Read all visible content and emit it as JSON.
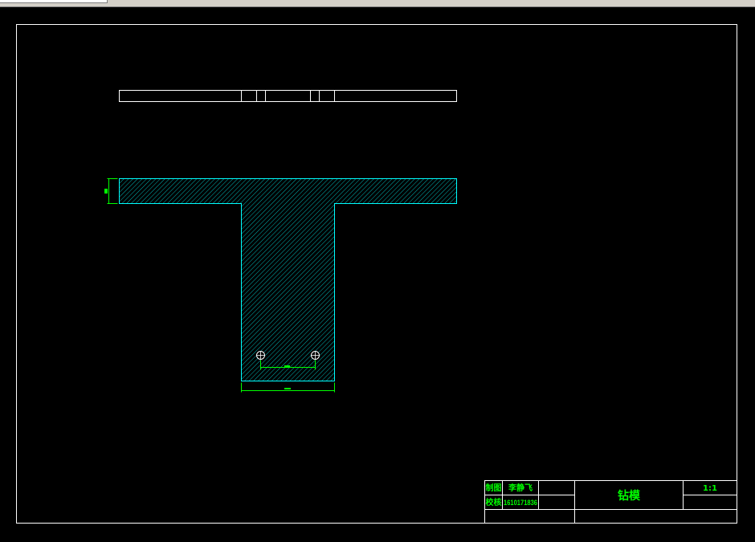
{
  "title_block": {
    "drawn_label": "制图",
    "drawn_value": "李静飞",
    "checked_label": "校核",
    "checked_value": "1610171836",
    "drawing_name": "钻模",
    "scale": "1:1"
  },
  "colors": {
    "background": "#000000",
    "frame": "#ffffff",
    "outline": "#00ffff",
    "hatch": "#00b4b4",
    "dimension": "#00ff00",
    "title_text": "#00ff00",
    "table_lines": "#ffffff",
    "holes": "#ffffff"
  },
  "icons": {
    "drill_hole": "circle-with-crosshair"
  }
}
